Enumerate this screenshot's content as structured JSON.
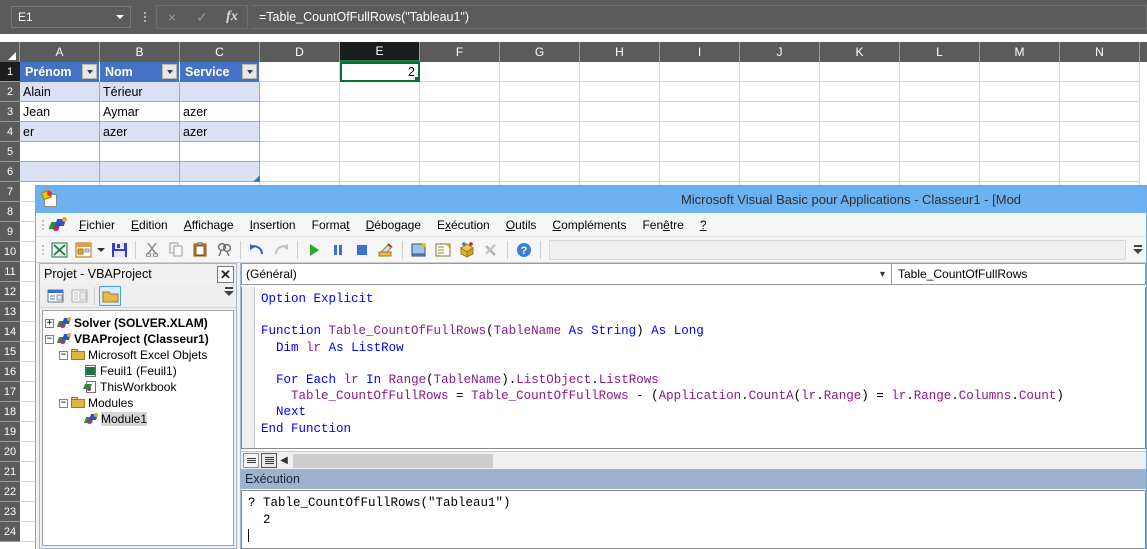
{
  "excel": {
    "name_box": "E1",
    "formula": "=Table_CountOfFullRows(\"Tableau1\")",
    "cancel_icon": "×",
    "confirm_icon": "✓",
    "fx_label": "fx",
    "columns": [
      "A",
      "B",
      "C",
      "D",
      "E",
      "F",
      "G",
      "H",
      "I",
      "J",
      "K",
      "L",
      "M",
      "N"
    ],
    "selected_column": "E",
    "rows": [
      "1",
      "2",
      "3",
      "4",
      "5",
      "6",
      "7",
      "8",
      "9",
      "10",
      "11",
      "12",
      "13",
      "14",
      "15",
      "16",
      "17",
      "18",
      "19",
      "20",
      "21",
      "22",
      "23",
      "24"
    ],
    "selected_row": "1",
    "table_headers": [
      "Prénom",
      "Nom",
      "Service"
    ],
    "table_rows": [
      [
        "Alain",
        "Térieur",
        ""
      ],
      [
        "Jean",
        "Aymar",
        "azer"
      ],
      [
        "er",
        "azer",
        "azer"
      ],
      [
        "",
        "",
        ""
      ]
    ],
    "selected_cell_value": "2"
  },
  "vbe": {
    "title": "Microsoft Visual Basic pour Applications - Classeur1 - [Mod",
    "menu": [
      "Fichier",
      "Edition",
      "Affichage",
      "Insertion",
      "Format",
      "Débogage",
      "Exécution",
      "Outils",
      "Compléments",
      "Fenêtre",
      "?"
    ],
    "toolbar_icons": [
      "excel-view-icon",
      "insert-userform-icon",
      "save-icon",
      "cut-icon",
      "copy-icon",
      "paste-icon",
      "find-icon",
      "undo-icon",
      "redo-icon",
      "run-icon",
      "break-icon",
      "reset-icon",
      "design-mode-icon",
      "project-explorer-icon",
      "properties-window-icon",
      "object-browser-icon",
      "toolbox-icon",
      "help-icon"
    ],
    "project": {
      "title": "Projet - VBAProject",
      "close_label": "✕",
      "toolbar_icons": [
        "view-code-icon",
        "view-object-icon",
        "toggle-folders-icon"
      ],
      "tree": [
        {
          "label": "Solver (SOLVER.XLAM)",
          "expander": "+",
          "icon": "vba-project-icon",
          "depth": 0,
          "bold": true
        },
        {
          "label": "VBAProject (Classeur1)",
          "expander": "−",
          "icon": "vba-project-icon",
          "depth": 0,
          "bold": true
        },
        {
          "label": "Microsoft Excel Objets",
          "expander": "−",
          "icon": "folder-icon",
          "depth": 1,
          "bold": false
        },
        {
          "label": "Feuil1 (Feuil1)",
          "expander": "",
          "icon": "worksheet-icon",
          "depth": 2,
          "bold": false
        },
        {
          "label": "ThisWorkbook",
          "expander": "",
          "icon": "workbook-icon",
          "depth": 2,
          "bold": false
        },
        {
          "label": "Modules",
          "expander": "−",
          "icon": "folder-icon",
          "depth": 1,
          "bold": false
        },
        {
          "label": "Module1",
          "expander": "",
          "icon": "module-icon",
          "depth": 2,
          "bold": false,
          "selected": true
        }
      ]
    },
    "code": {
      "object_combo": "(Général)",
      "proc_combo": "Table_CountOfFullRows",
      "lines": [
        "Option Explicit",
        "",
        "Function Table_CountOfFullRows(TableName As String) As Long",
        "  Dim lr As ListRow",
        "",
        "  For Each lr In Range(TableName).ListObject.ListRows",
        "    Table_CountOfFullRows = Table_CountOfFullRows - (Application.CountA(lr.Range) = lr.Range.Columns.Count)",
        "  Next",
        "End Function"
      ]
    },
    "immediate": {
      "title": "Exécution",
      "lines": [
        "? Table_CountOfFullRows(\"Tableau1\")",
        "  2"
      ]
    }
  },
  "colors": {
    "excel_chrome": "#5b5b5b",
    "excel_accent": "#107c41",
    "table_header": "#4472c4",
    "table_band": "#d9e1f2",
    "vbe_titlebar": "#6cb1f0",
    "immediate_titlebar": "#9db3cd",
    "vba_keyword": "#0000ff",
    "vba_identifier": "#8b1a8b"
  }
}
